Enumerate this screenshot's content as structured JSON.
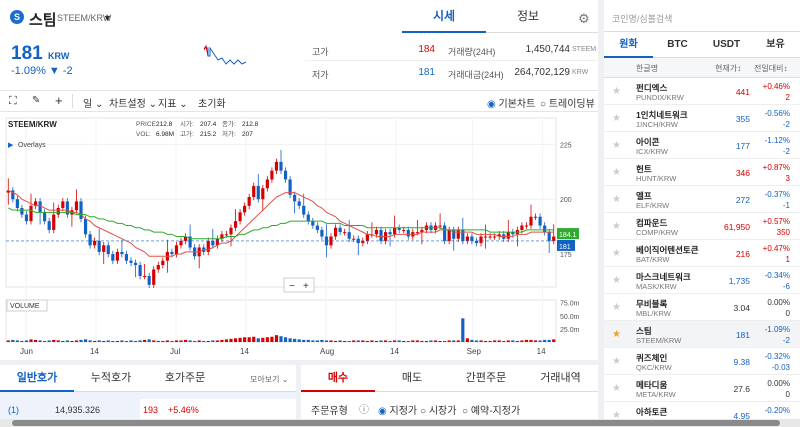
{
  "coin": {
    "name": "스팀",
    "pair": "STEEM/KRW",
    "price": "181",
    "unit": "KRW",
    "change": "-1.09% ▼ -2",
    "logo": "S"
  },
  "tabs": {
    "main": "시세",
    "info": "정보"
  },
  "stats": [
    {
      "label": "고가",
      "value": "184",
      "color": "up"
    },
    {
      "label": "거래량(24H)",
      "value": "1,450,744",
      "unit": "STEEM"
    },
    {
      "label": "저가",
      "value": "181",
      "color": "down"
    },
    {
      "label": "거래대금(24H)",
      "value": "264,702,129",
      "unit": "KRW"
    }
  ],
  "toolbar": {
    "interval": "일",
    "settings": "차트설정",
    "indicator": "지표",
    "reset": "초기화",
    "basic_chart": "기본차트",
    "trading_view": "트레이딩뷰"
  },
  "chart_info": {
    "symbol": "STEEM/KRW",
    "overlays": "Overlays",
    "volume_label": "VOLUME",
    "ohlc": [
      {
        "k": "PRICE:",
        "v": "212.8"
      },
      {
        "k": "시가:",
        "v": "207.4"
      },
      {
        "k": "종가:",
        "v": "212.8"
      },
      {
        "k": "VOL:",
        "v": "6.98M"
      },
      {
        "k": "고가:",
        "v": "215.2"
      },
      {
        "k": "저가:",
        "v": "207"
      }
    ],
    "zoom_minus": "−",
    "zoom_plus": "+",
    "last_price_tag": "181",
    "ma_tag": "184.1"
  },
  "chart_data": {
    "type": "candlestick",
    "title": "STEEM/KRW",
    "xlabel": "",
    "ylabel": "",
    "x_ticks": [
      "Jun",
      "14",
      "Jul",
      "14",
      "Aug",
      "14",
      "Sep",
      "14"
    ],
    "y_ticks": [
      "225",
      "200",
      "175"
    ],
    "volume_ticks": [
      "75.0m",
      "50.0m",
      "25.0m"
    ],
    "ylim": [
      160,
      237
    ],
    "volume_max": 80,
    "grid": true,
    "close": [
      204,
      200,
      196,
      193,
      190,
      197,
      199,
      194,
      190,
      186,
      193,
      196,
      199,
      193,
      195,
      199,
      191,
      184,
      179,
      181,
      176,
      179,
      175,
      172,
      176,
      175,
      172,
      171,
      170,
      165,
      165,
      161,
      168,
      170,
      172,
      176,
      175,
      179,
      181,
      183,
      178,
      174,
      178,
      176,
      181,
      179,
      182,
      184,
      184,
      187,
      190,
      194,
      197,
      201,
      206,
      200,
      205,
      209,
      213,
      217,
      213,
      209,
      202,
      199,
      197,
      193,
      190,
      188,
      186,
      183,
      179,
      183,
      187,
      185,
      185,
      182,
      182,
      180,
      181,
      184,
      184,
      186,
      181,
      185,
      184,
      187,
      186,
      186,
      183,
      185,
      185,
      186,
      188,
      186,
      188,
      188,
      181,
      186,
      182,
      186,
      181,
      183,
      181,
      180,
      183,
      183,
      183,
      183,
      184,
      182,
      185,
      184,
      186,
      188,
      188,
      192,
      192,
      188,
      185,
      181,
      183
    ],
    "ma_red": [
      204,
      203,
      202,
      200,
      199,
      198,
      197,
      197,
      196,
      195,
      195,
      195,
      195,
      195,
      194,
      194,
      193,
      191,
      190,
      188,
      187,
      186,
      185,
      184,
      183,
      182,
      181,
      180,
      178,
      177,
      176,
      174,
      174,
      174,
      174,
      174,
      174,
      175,
      175,
      176,
      176,
      176,
      176,
      177,
      177,
      178,
      179,
      180,
      180,
      181,
      183,
      185,
      187,
      189,
      191,
      193,
      195,
      197,
      199,
      201,
      202,
      203,
      203,
      203,
      202,
      201,
      200,
      199,
      197,
      196,
      194,
      193,
      192,
      190,
      189,
      188,
      187,
      186,
      185,
      184,
      184,
      183,
      183,
      183,
      183,
      184,
      184,
      184,
      184,
      184,
      184,
      185,
      185,
      185,
      185,
      186,
      186,
      186,
      185,
      185,
      185,
      185,
      185,
      184,
      184,
      184,
      184,
      184,
      183,
      183,
      183,
      183,
      184,
      184,
      184,
      185,
      185,
      185,
      185,
      185,
      185
    ],
    "ma_green": [
      196,
      195,
      195,
      195,
      195,
      195,
      194,
      194,
      194,
      194,
      194,
      194,
      194,
      194,
      194,
      193,
      193,
      193,
      192,
      192,
      191,
      191,
      190,
      190,
      189,
      189,
      188,
      188,
      187,
      187,
      186,
      186,
      185,
      185,
      185,
      184,
      184,
      183,
      183,
      183,
      182,
      182,
      182,
      182,
      182,
      182,
      182,
      182,
      183,
      183,
      183,
      184,
      184,
      185,
      186,
      186,
      187,
      187,
      188,
      188,
      189,
      189,
      190,
      190,
      190,
      190,
      190,
      190,
      190,
      190,
      189,
      189,
      189,
      189,
      188,
      188,
      188,
      188,
      188,
      187,
      187,
      187,
      187,
      187,
      187,
      187,
      187,
      187,
      187,
      187,
      187,
      187,
      187,
      187,
      187,
      187,
      186,
      186,
      186,
      186,
      186,
      186,
      186,
      186,
      186,
      186,
      185,
      185,
      185,
      185,
      185,
      185,
      185,
      185,
      186,
      186,
      186,
      186,
      186,
      186,
      186
    ],
    "volume": [
      3,
      4,
      3,
      2,
      3,
      5,
      4,
      3,
      2,
      3,
      4,
      3,
      2,
      3,
      2,
      3,
      4,
      5,
      3,
      2,
      3,
      2,
      3,
      2,
      2,
      3,
      2,
      3,
      2,
      3,
      4,
      5,
      3,
      2,
      2,
      3,
      2,
      3,
      3,
      4,
      3,
      2,
      3,
      2,
      2,
      3,
      3,
      4,
      5,
      6,
      7,
      8,
      9,
      9,
      10,
      7,
      8,
      9,
      10,
      13,
      11,
      9,
      7,
      6,
      5,
      4,
      4,
      3,
      3,
      4,
      3,
      3,
      2,
      3,
      2,
      2,
      3,
      3,
      3,
      2,
      3,
      2,
      3,
      3,
      2,
      3,
      3,
      2,
      2,
      3,
      3,
      2,
      2,
      3,
      3,
      2,
      2,
      3,
      3,
      3,
      45,
      7,
      4,
      3,
      3,
      2,
      2,
      3,
      3,
      2,
      3,
      3,
      2,
      3,
      4,
      4,
      3,
      3,
      4,
      4,
      5
    ]
  },
  "orderbook": {
    "tabs": [
      "일반호가",
      "누적호가",
      "호가주문"
    ],
    "dropdown": "모아보기",
    "row": {
      "idx": "(1)",
      "qty": "14,935.326",
      "price": "193",
      "pct": "+5.46%"
    }
  },
  "order": {
    "tabs": [
      "매수",
      "매도",
      "간편주문",
      "거래내역"
    ],
    "type_label": "주문유형",
    "opts": [
      "지정가",
      "시장가",
      "예약-지정가"
    ]
  },
  "market": {
    "search_placeholder": "코인명/심볼검색",
    "tabs": [
      "원화",
      "BTC",
      "USDT",
      "보유"
    ],
    "headers": [
      "한글명",
      "현재가",
      "전일대비"
    ],
    "rows": [
      {
        "name": "펀디엑스",
        "sym": "PUNDIX/KRW",
        "price": "441",
        "pct": "+0.46%",
        "diff": "2",
        "dir": "up",
        "star": false
      },
      {
        "name": "1인치네트워크",
        "sym": "1INCH/KRW",
        "price": "355",
        "pct": "-0.56%",
        "diff": "-2",
        "dir": "down",
        "star": false
      },
      {
        "name": "아이콘",
        "sym": "ICX/KRW",
        "price": "177",
        "pct": "-1.12%",
        "diff": "-2",
        "dir": "down",
        "star": false
      },
      {
        "name": "헌트",
        "sym": "HUNT/KRW",
        "price": "346",
        "pct": "+0.87%",
        "diff": "3",
        "dir": "up",
        "star": false
      },
      {
        "name": "엘프",
        "sym": "ELF/KRW",
        "price": "272",
        "pct": "-0.37%",
        "diff": "-1",
        "dir": "down",
        "star": false
      },
      {
        "name": "컴파운드",
        "sym": "COMP/KRW",
        "price": "61,950",
        "pct": "+0.57%",
        "diff": "350",
        "dir": "up",
        "star": false
      },
      {
        "name": "베이직어텐션토큰",
        "sym": "BAT/KRW",
        "price": "216",
        "pct": "+0.47%",
        "diff": "1",
        "dir": "up",
        "star": false
      },
      {
        "name": "마스크네트워크",
        "sym": "MASK/KRW",
        "price": "1,735",
        "pct": "-0.34%",
        "diff": "-6",
        "dir": "down",
        "star": false
      },
      {
        "name": "무비블록",
        "sym": "MBL/KRW",
        "price": "3.04",
        "pct": "0.00%",
        "diff": "0",
        "dir": "flat",
        "star": false
      },
      {
        "name": "스팀",
        "sym": "STEEM/KRW",
        "price": "181",
        "pct": "-1.09%",
        "diff": "-2",
        "dir": "down",
        "star": true,
        "sel": true
      },
      {
        "name": "퀴즈체인",
        "sym": "QKC/KRW",
        "price": "9.38",
        "pct": "-0.32%",
        "diff": "-0.03",
        "dir": "down",
        "star": false
      },
      {
        "name": "메타디움",
        "sym": "META/KRW",
        "price": "27.6",
        "pct": "0.00%",
        "diff": "0",
        "dir": "flat",
        "star": false
      },
      {
        "name": "아하토큰",
        "sym": "AHT/KRW",
        "price": "4.95",
        "pct": "-0.20%",
        "diff": "",
        "dir": "down",
        "star": false
      }
    ]
  },
  "colors": {
    "up": "#d60000",
    "down": "#1261c4",
    "ma_red": "#e0504a",
    "ma_green": "#2eaa2e",
    "accent": "#1261c4"
  }
}
